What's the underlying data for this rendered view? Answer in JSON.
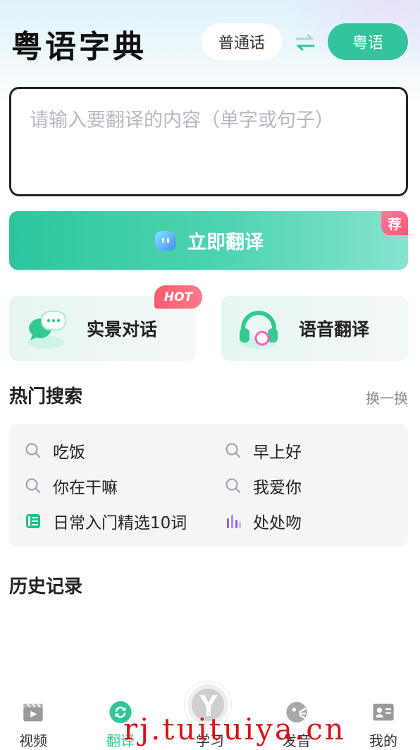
{
  "header": {
    "title": "粤语字典",
    "source_language": "普通话",
    "target_language": "粤语"
  },
  "input": {
    "placeholder": "请输入要翻译的内容（单字或句子）",
    "value": ""
  },
  "translate_button": {
    "label": "立即翻译",
    "badge": "荐"
  },
  "features": [
    {
      "label": "实景对话",
      "badge": "HOT"
    },
    {
      "label": "语音翻译"
    }
  ],
  "hot_search": {
    "title": "热门搜索",
    "refresh_label": "换一换",
    "items": [
      {
        "text": "吃饭",
        "icon": "search-icon"
      },
      {
        "text": "早上好",
        "icon": "search-icon"
      },
      {
        "text": "你在干嘛",
        "icon": "search-icon"
      },
      {
        "text": "我爱你",
        "icon": "search-icon"
      },
      {
        "text": "日常入门精选10词",
        "icon": "list-icon"
      },
      {
        "text": "处处吻",
        "icon": "audio-bars-icon"
      }
    ]
  },
  "history": {
    "title": "历史记录"
  },
  "tabbar": {
    "items": [
      {
        "label": "视频",
        "icon": "video-icon"
      },
      {
        "label": "翻译",
        "icon": "translate-icon",
        "active": true
      },
      {
        "label": "学习",
        "icon": "y-logo-icon"
      },
      {
        "label": "发音",
        "icon": "pronounce-icon"
      },
      {
        "label": "我的",
        "icon": "profile-card-icon"
      }
    ]
  },
  "watermark": "rj.tuituiya.cn",
  "colors": {
    "accent": "#33c49c",
    "hot_badge": "#ff5a6e",
    "placeholder": "#b5b9c0"
  }
}
